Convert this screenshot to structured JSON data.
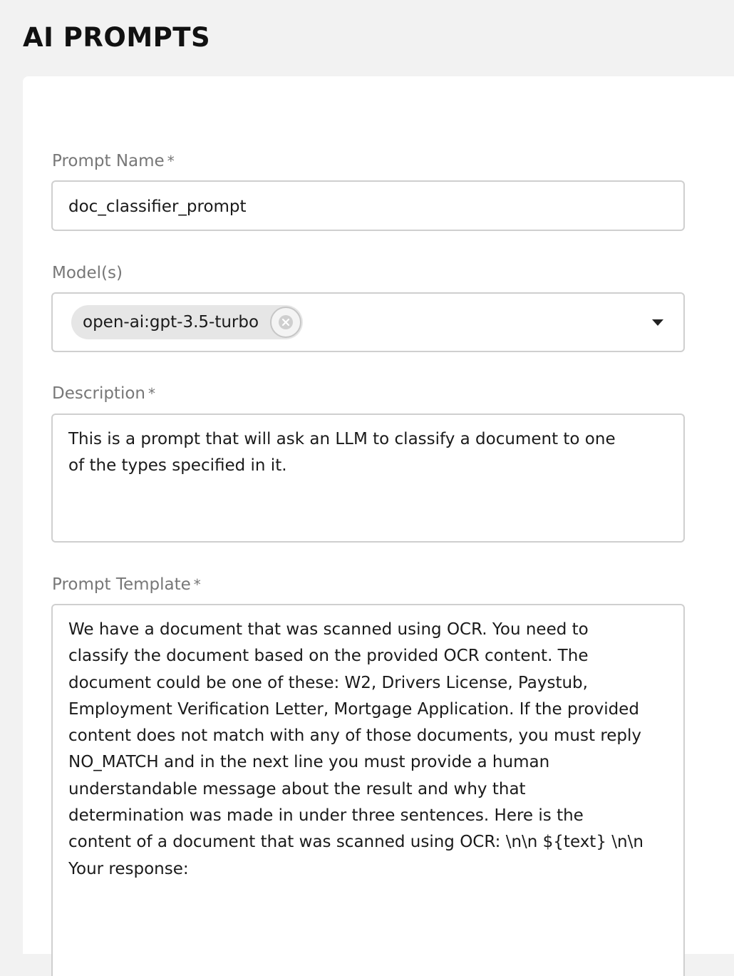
{
  "page": {
    "title": "AI PROMPTS"
  },
  "form": {
    "prompt_name": {
      "label": "Prompt Name",
      "required_mark": "*",
      "value": "doc_classifier_prompt"
    },
    "models": {
      "label": "Model(s)",
      "selected": [
        {
          "label": "open-ai:gpt-3.5-turbo",
          "remove_icon": "close-circle-icon"
        }
      ],
      "dropdown_icon": "caret-down-icon"
    },
    "description": {
      "label": "Description",
      "required_mark": "*",
      "value": "This is a prompt that will ask an LLM to classify a document to one of the types specified in it."
    },
    "prompt_template": {
      "label": "Prompt Template",
      "required_mark": "*",
      "value": "We have a document that was scanned using OCR. You need to classify the document based on the provided OCR content. The document could be one of these: W2, Drivers License, Paystub, Employment Verification Letter, Mortgage Application. If the provided content does not match with any of those documents, you must reply NO_MATCH and in the next line you must provide a human understandable message about the result and why that determination was made in under three sentences. Here is the content of a document that was scanned using OCR: \\n\\n ${text} \\n\\n Your response:"
    }
  }
}
